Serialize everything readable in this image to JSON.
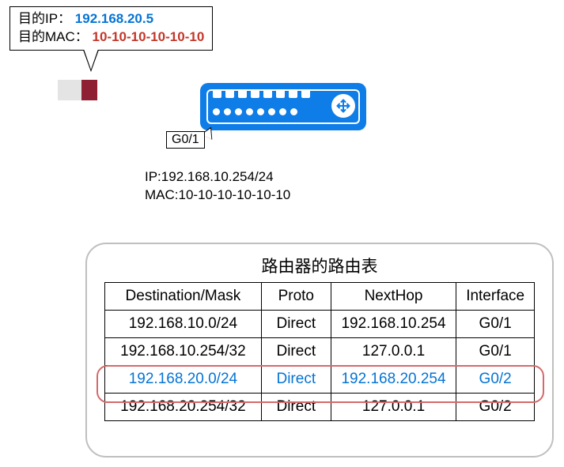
{
  "bubble": {
    "dest_ip_label": "目的IP：",
    "dest_ip": "192.168.20.5",
    "dest_mac_label": "目的MAC：",
    "dest_mac": "10-10-10-10-10-10"
  },
  "iface_label": "G0/1",
  "iface_info": {
    "ip_line": "IP:192.168.10.254/24",
    "mac_line": "MAC:10-10-10-10-10-10"
  },
  "routing_table": {
    "title": "路由器的路由表",
    "headers": {
      "dest": "Destination/Mask",
      "proto": "Proto",
      "nexthop": "NextHop",
      "iface": "Interface"
    },
    "rows": [
      {
        "dest": "192.168.10.0/24",
        "proto": "Direct",
        "nexthop": "192.168.10.254",
        "iface": "G0/1",
        "hl": false
      },
      {
        "dest": "192.168.10.254/32",
        "proto": "Direct",
        "nexthop": "127.0.0.1",
        "iface": "G0/1",
        "hl": false
      },
      {
        "dest": "192.168.20.0/24",
        "proto": "Direct",
        "nexthop": "192.168.20.254",
        "iface": "G0/2",
        "hl": true
      },
      {
        "dest": "192.168.20.254/32",
        "proto": "Direct",
        "nexthop": "127.0.0.1",
        "iface": "G0/2",
        "hl": false
      }
    ]
  }
}
